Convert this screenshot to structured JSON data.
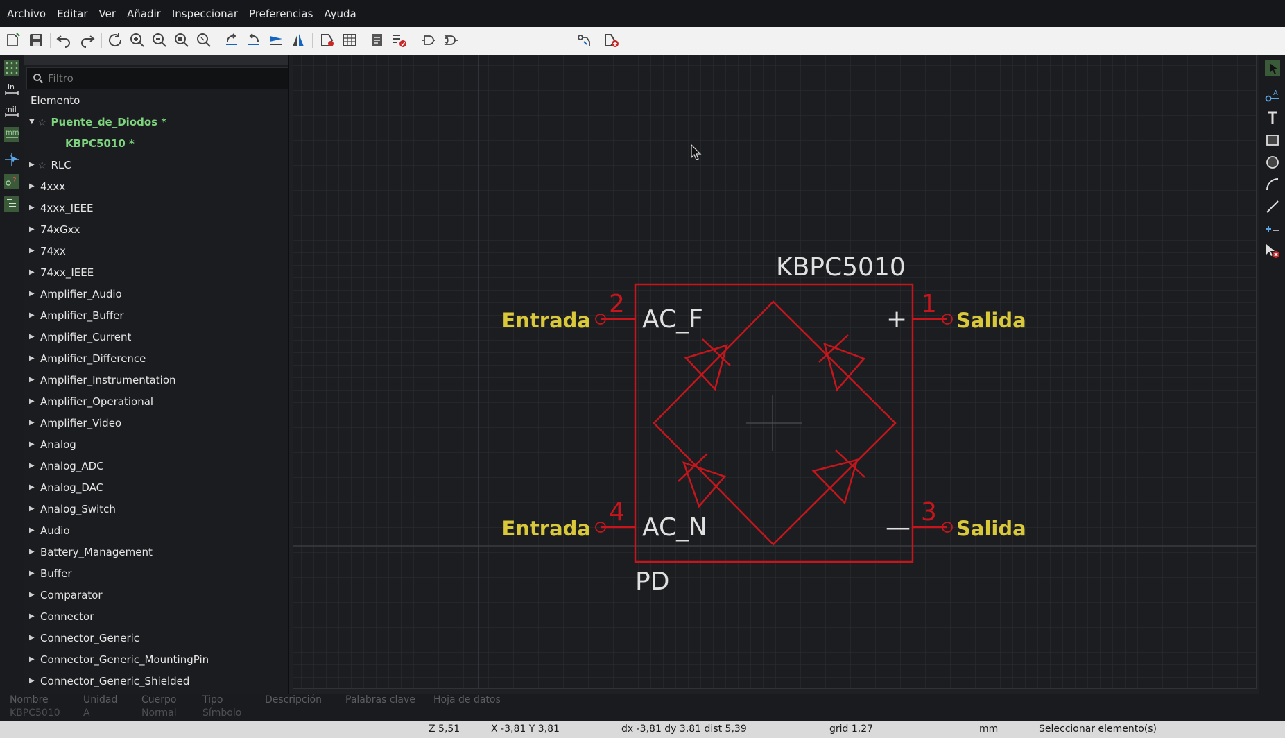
{
  "menu": [
    "Archivo",
    "Editar",
    "Ver",
    "Añadir",
    "Inspeccionar",
    "Preferencias",
    "Ayuda"
  ],
  "toolbar_icons": [
    "new-symbol-icon",
    "save-icon",
    "undo-icon",
    "redo-icon",
    "refresh-icon",
    "zoom-in-icon",
    "zoom-out-icon",
    "zoom-fit-icon",
    "zoom-selection-icon",
    "rotate-ccw-icon",
    "rotate-cw-icon",
    "mirror-vertical-icon",
    "mirror-horizontal-icon",
    "symbol-properties-icon",
    "pin-table-icon",
    "datasheet-icon",
    "check-symbol-icon",
    "de-morgan-standard-icon",
    "de-morgan-alternate-icon",
    "hide-pins-icon",
    "add-to-schematic-icon"
  ],
  "left_tools": [
    "grid-icon",
    "inches-icon",
    "mils-icon",
    "millimeters-icon",
    "cursor-crosshair-icon",
    "electrical-type-icon",
    "library-tree-toggle-icon"
  ],
  "left_tool_labels": {
    "inches": "in",
    "mils": "mil",
    "mm": "mm"
  },
  "search": {
    "placeholder": "Filtro"
  },
  "tree_header": "Elemento",
  "tree": [
    {
      "label": "Puente_de_Diodos *",
      "expanded": true,
      "starred": true,
      "highlight": true,
      "level": 0
    },
    {
      "label": "KBPC5010 *",
      "highlight": true,
      "level": 1
    },
    {
      "label": "RLC",
      "starred": true,
      "level": 0
    },
    {
      "label": "4xxx",
      "level": 0
    },
    {
      "label": "4xxx_IEEE",
      "level": 0
    },
    {
      "label": "74xGxx",
      "level": 0
    },
    {
      "label": "74xx",
      "level": 0
    },
    {
      "label": "74xx_IEEE",
      "level": 0
    },
    {
      "label": "Amplifier_Audio",
      "level": 0
    },
    {
      "label": "Amplifier_Buffer",
      "level": 0
    },
    {
      "label": "Amplifier_Current",
      "level": 0
    },
    {
      "label": "Amplifier_Difference",
      "level": 0
    },
    {
      "label": "Amplifier_Instrumentation",
      "level": 0
    },
    {
      "label": "Amplifier_Operational",
      "level": 0
    },
    {
      "label": "Amplifier_Video",
      "level": 0
    },
    {
      "label": "Analog",
      "level": 0
    },
    {
      "label": "Analog_ADC",
      "level": 0
    },
    {
      "label": "Analog_DAC",
      "level": 0
    },
    {
      "label": "Analog_Switch",
      "level": 0
    },
    {
      "label": "Audio",
      "level": 0
    },
    {
      "label": "Battery_Management",
      "level": 0
    },
    {
      "label": "Buffer",
      "level": 0
    },
    {
      "label": "Comparator",
      "level": 0
    },
    {
      "label": "Connector",
      "level": 0
    },
    {
      "label": "Connector_Generic",
      "level": 0
    },
    {
      "label": "Connector_Generic_MountingPin",
      "level": 0
    },
    {
      "label": "Connector_Generic_Shielded",
      "level": 0
    }
  ],
  "symbol": {
    "value": "KBPC5010",
    "reference": "PD",
    "pins": [
      {
        "number": "2",
        "name": "AC_F",
        "label": "Entrada",
        "side": "left"
      },
      {
        "number": "4",
        "name": "AC_N",
        "label": "Entrada",
        "side": "left"
      },
      {
        "number": "1",
        "name": "+",
        "label": "Salida",
        "side": "right"
      },
      {
        "number": "3",
        "name": "—",
        "label": "Salida",
        "side": "right"
      }
    ]
  },
  "colors": {
    "body": "#c4161c",
    "label": "#d8c83a",
    "text": "#e0e0e0",
    "tree_highlight": "#7ed37e",
    "grid": "#2e3034"
  },
  "right_tools": [
    "select-icon",
    "add-pin-icon",
    "add-text-icon",
    "add-rectangle-icon",
    "add-circle-icon",
    "add-arc-icon",
    "add-line-icon",
    "set-anchor-icon",
    "delete-tool-icon"
  ],
  "properties": {
    "headers": [
      "Nombre",
      "Unidad",
      "Cuerpo",
      "Tipo",
      "Descripción",
      "Palabras clave",
      "Hoja de datos"
    ],
    "values": [
      "KBPC5010",
      "A",
      "Normal",
      "Símbolo",
      "",
      "",
      ""
    ]
  },
  "status": {
    "zoom": "Z 5,51",
    "xy": "X -3,81  Y 3,81",
    "delta": "dx -3,81  dy 3,81  dist 5,39",
    "grid": "grid 1,27",
    "units": "mm",
    "message": "Seleccionar elemento(s)"
  }
}
